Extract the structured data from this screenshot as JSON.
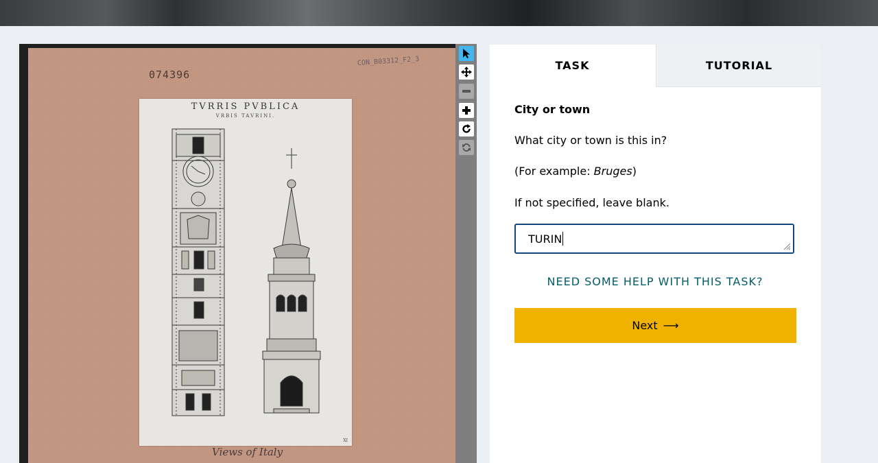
{
  "subject": {
    "accession_number": "074396",
    "shelfmark": "CON_B03312_F2_3",
    "print_title": "TVRRIS PVBLICA",
    "print_subtitle": "VRBIS TAVRINI.",
    "plate_number": "XI",
    "handwritten_note": "Views of Italy"
  },
  "toolbar": {
    "tools": [
      {
        "name": "annotate-tool",
        "icon": "cursor-arrow-icon",
        "state": "active"
      },
      {
        "name": "move-tool",
        "icon": "move-arrows-icon",
        "state": "enabled"
      },
      {
        "name": "zoom-out-tool",
        "icon": "minus-icon",
        "state": "disabled"
      },
      {
        "name": "zoom-in-tool",
        "icon": "plus-icon",
        "state": "enabled"
      },
      {
        "name": "rotate-tool",
        "icon": "rotate-icon",
        "state": "enabled"
      },
      {
        "name": "reset-tool",
        "icon": "refresh-icon",
        "state": "disabled"
      }
    ],
    "active_color": "#41b6f0"
  },
  "tabs": {
    "task": "TASK",
    "tutorial": "TUTORIAL"
  },
  "task": {
    "heading": "City or town",
    "question": "What city or town is this in?",
    "example_prefix": "(For example: ",
    "example_value": "Bruges",
    "example_suffix": ")",
    "instruction": "If not specified, leave blank.",
    "answer_value": "TURIN",
    "help_link": "NEED SOME HELP WITH THIS TASK?",
    "next_label": "Next",
    "next_color": "#f0b200"
  }
}
